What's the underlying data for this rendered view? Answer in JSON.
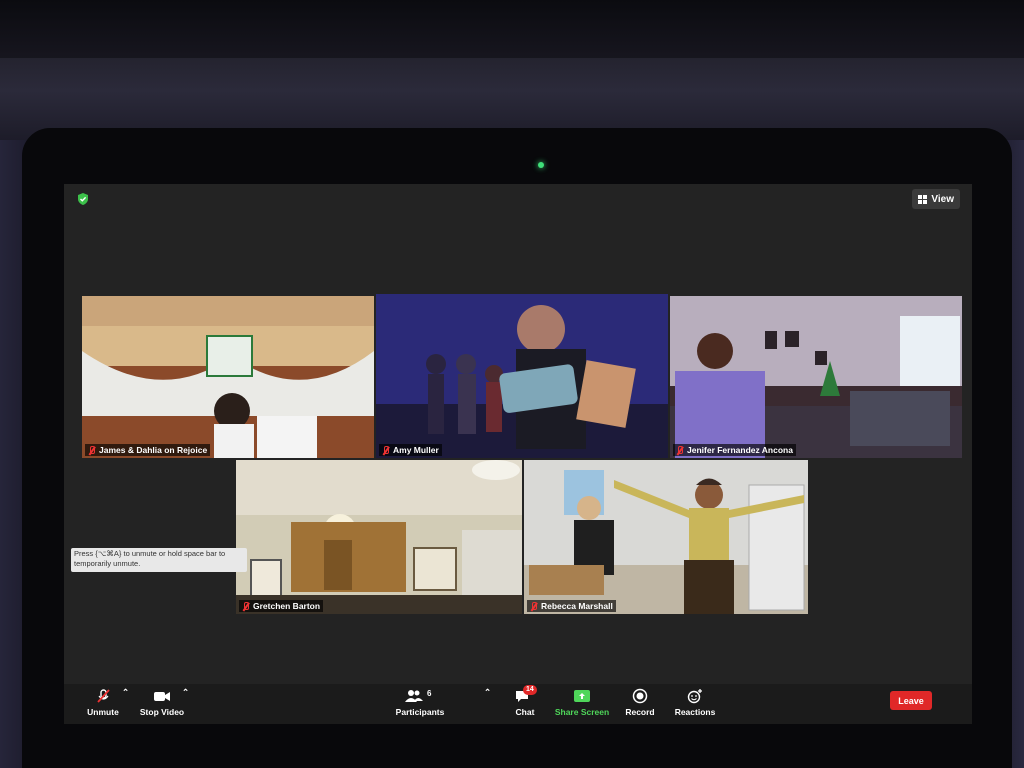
{
  "view_button": {
    "label": "View"
  },
  "participants_tiles": [
    {
      "name": "James & Dahlia on Rejoice",
      "muted": true
    },
    {
      "name": "Amy Muller",
      "muted": true,
      "active_speaker": true
    },
    {
      "name": "Jenifer Fernandez Ancona",
      "muted": true
    },
    {
      "name": "Gretchen Barton",
      "muted": true
    },
    {
      "name": "Rebecca Marshall",
      "muted": true
    }
  ],
  "toolbar": {
    "unmute_label": "Unmute",
    "stop_video_label": "Stop Video",
    "participants_label": "Participants",
    "participants_count": "6",
    "chat_label": "Chat",
    "chat_badge": "14",
    "share_screen_label": "Share Screen",
    "record_label": "Record",
    "reactions_label": "Reactions",
    "leave_label": "Leave"
  },
  "tooltip": {
    "text": "Press {⌥⌘A} to unmute or hold space bar to temporarily unmute."
  },
  "colors": {
    "active_speaker_border": "#d8e84a",
    "share_green": "#4fd65a",
    "leave_red": "#e02828",
    "muted_red": "#e33333"
  }
}
